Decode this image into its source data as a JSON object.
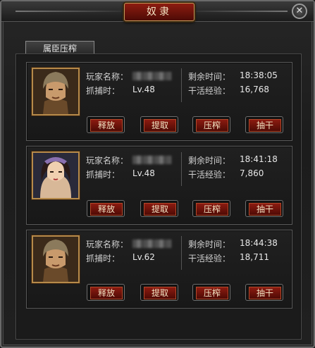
{
  "window": {
    "title": "奴隶"
  },
  "tab": {
    "label": "属臣压榨"
  },
  "labels": {
    "player_name": "玩家名称：",
    "capture_time": "抓捕时：",
    "remaining_time": "剩余时间：",
    "work_exp": "干活经验："
  },
  "buttons": {
    "release": "释放",
    "extract": "提取",
    "squeeze": "压榨",
    "work": "抽干"
  },
  "slaves": [
    {
      "portrait": "warrior-male-portrait",
      "level": "Lv.48",
      "remaining": "18:38:05",
      "exp": "16,768"
    },
    {
      "portrait": "woman-portrait",
      "level": "Lv.48",
      "remaining": "18:41:18",
      "exp": "7,860"
    },
    {
      "portrait": "warrior-male-portrait",
      "level": "Lv.62",
      "remaining": "18:44:38",
      "exp": "18,711"
    }
  ],
  "colors": {
    "accent_red": "#8c1b10",
    "gold_border": "#b68a4a",
    "text": "#e8e8e8"
  }
}
